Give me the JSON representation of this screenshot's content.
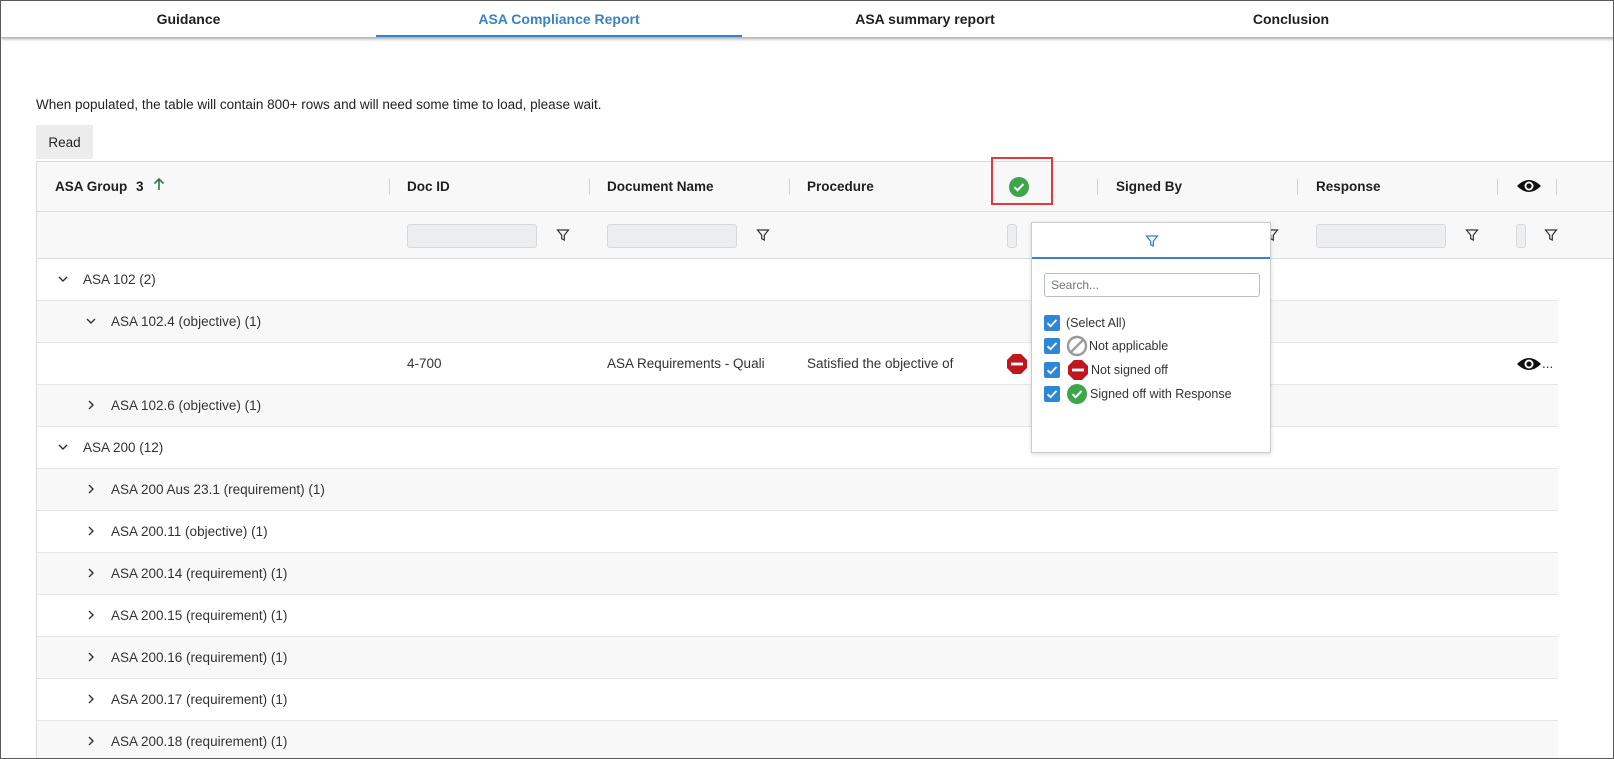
{
  "tabs": [
    {
      "label": "Guidance",
      "active": false
    },
    {
      "label": "ASA Compliance Report",
      "active": true
    },
    {
      "label": "ASA summary report",
      "active": false
    },
    {
      "label": "Conclusion",
      "active": false
    }
  ],
  "note": "When populated, the table will contain 800+ rows and will need some time to load, please wait.",
  "read_button": "Read",
  "columns": {
    "group": "ASA Group",
    "group_sort_index": "3",
    "doc_id": "Doc ID",
    "document_name": "Document Name",
    "procedure": "Procedure",
    "signed_by": "Signed By",
    "response": "Response"
  },
  "rows": [
    {
      "label": "ASA 102 (2)",
      "level": 0,
      "expanded": true
    },
    {
      "label": "ASA 102.4 (objective) (1)",
      "level": 1,
      "expanded": true
    },
    {
      "doc_id": "4-700",
      "document_name": "ASA Requirements - Quali",
      "procedure": "Satisfied the objective of",
      "status": "not-signed-off",
      "view": "..."
    },
    {
      "label": "ASA 102.6 (objective) (1)",
      "level": 1,
      "expanded": false
    },
    {
      "label": "ASA 200 (12)",
      "level": 0,
      "expanded": true
    },
    {
      "label": "ASA 200 Aus 23.1 (requirement) (1)",
      "level": 1,
      "expanded": false
    },
    {
      "label": "ASA 200.11 (objective) (1)",
      "level": 1,
      "expanded": false
    },
    {
      "label": "ASA 200.14 (requirement) (1)",
      "level": 1,
      "expanded": false
    },
    {
      "label": "ASA 200.15 (requirement) (1)",
      "level": 1,
      "expanded": false
    },
    {
      "label": "ASA 200.16 (requirement) (1)",
      "level": 1,
      "expanded": false
    },
    {
      "label": "ASA 200.17 (requirement) (1)",
      "level": 1,
      "expanded": false
    },
    {
      "label": "ASA 200.18 (requirement) (1)",
      "level": 1,
      "expanded": false
    }
  ],
  "filter_popup": {
    "search_placeholder": "Search...",
    "options": [
      {
        "label": "(Select All)",
        "checked": true,
        "icon": "none"
      },
      {
        "label": "Not applicable",
        "checked": true,
        "icon": "not-applicable-icon"
      },
      {
        "label": "Not signed off",
        "checked": true,
        "icon": "not-signed-off-icon"
      },
      {
        "label": "Signed off with Response",
        "checked": true,
        "icon": "signed-off-icon"
      }
    ]
  },
  "colors": {
    "accent": "#3a82c4",
    "check_green": "#3fa54a",
    "stop_red": "#c0171e",
    "highlight": "#e03a3a",
    "checkbox_blue": "#2f86d6"
  }
}
